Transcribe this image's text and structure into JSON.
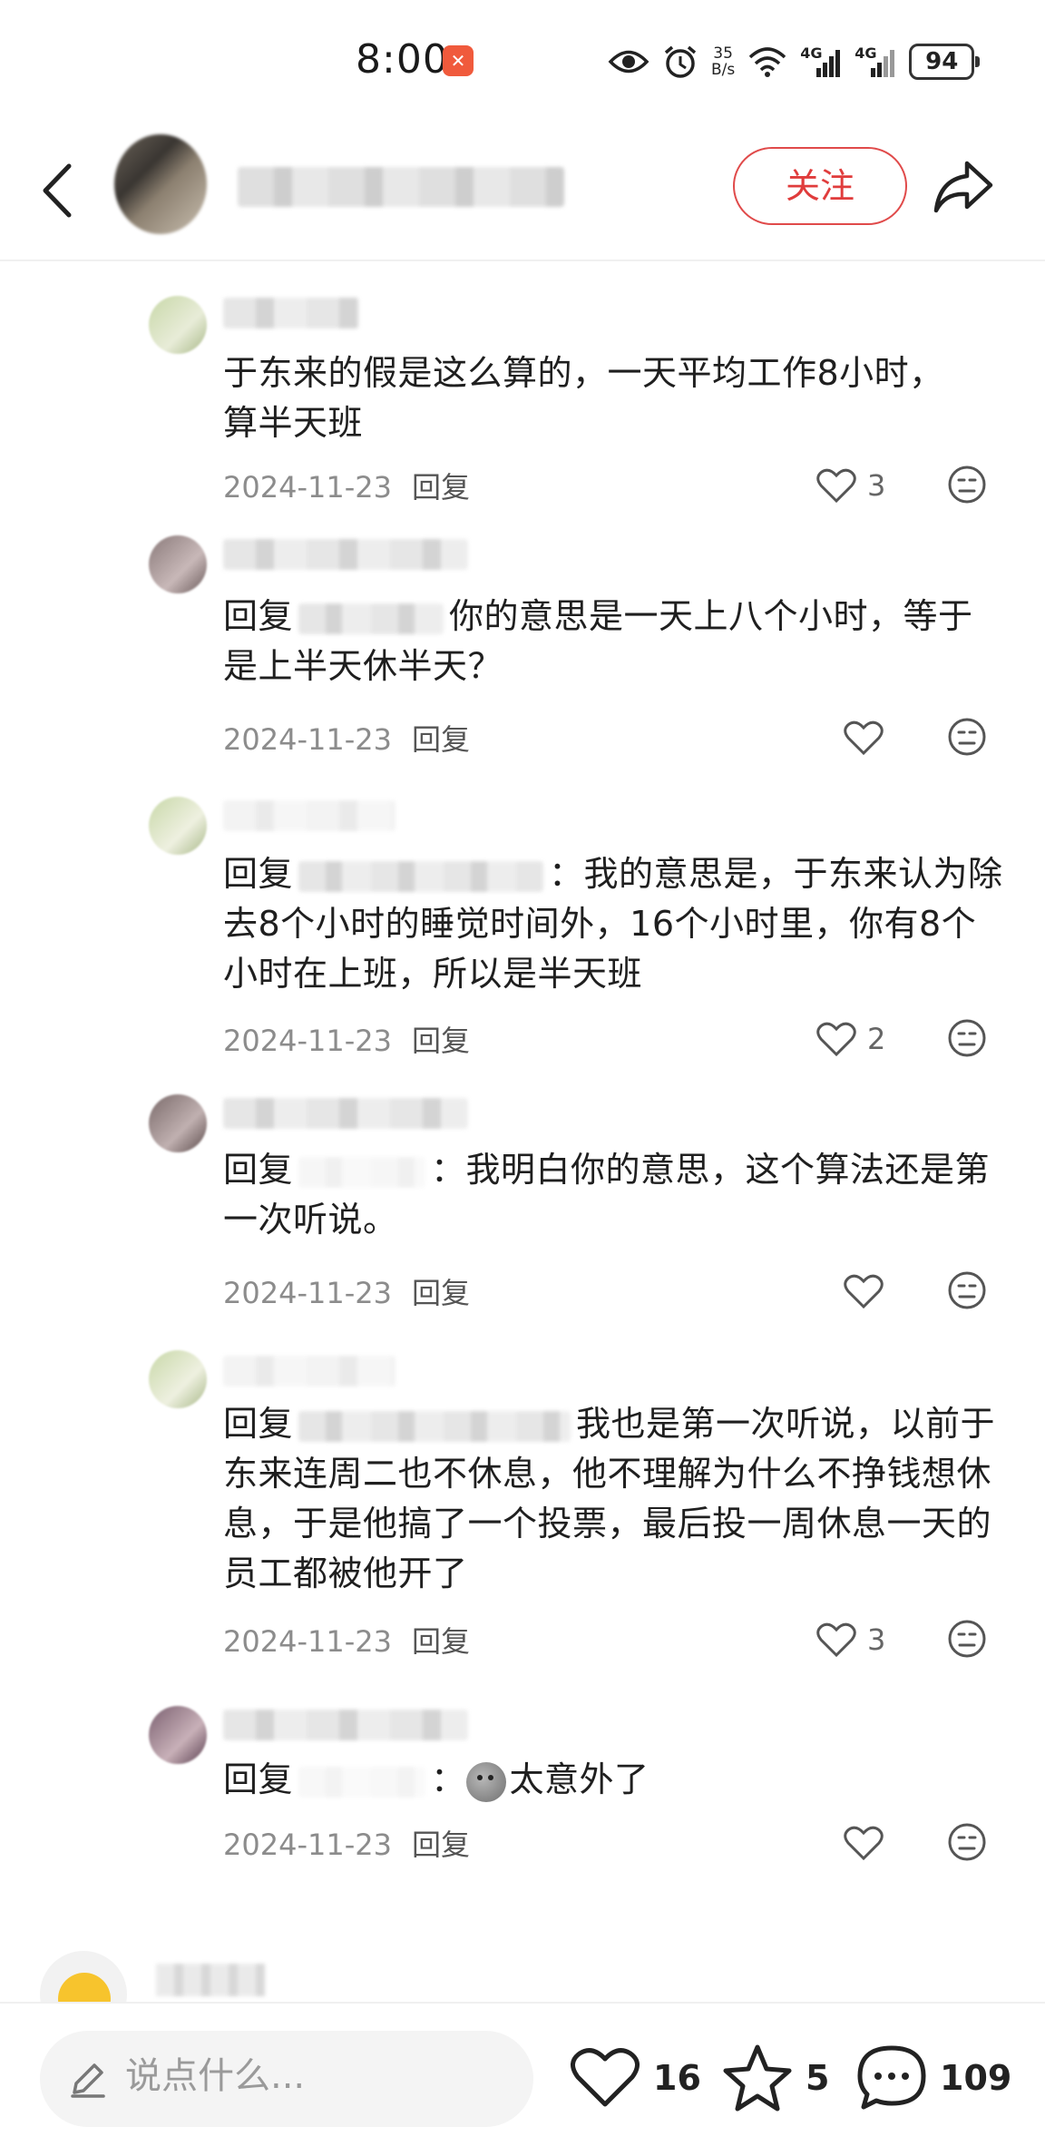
{
  "status_bar": {
    "time": "8:00",
    "net_speed_value": "35",
    "net_speed_unit": "B/s",
    "signal1_label": "4G",
    "signal2_label": "4G",
    "battery": "94"
  },
  "header": {
    "follow_label": "关注"
  },
  "comments": [
    {
      "text": "于东来的假是这么算的，一天平均工作8小时，算半天班",
      "date": "2024-11-23",
      "reply_label": "回复",
      "likes": "3"
    },
    {
      "reply_prefix": "回复",
      "text": "你的意思是一天上八个小时，等于是上半天休半天？",
      "date": "2024-11-23",
      "reply_label": "回复",
      "likes": ""
    },
    {
      "reply_prefix": "回复",
      "text": "：我的意思是，于东来认为除去8个小时的睡觉时间外，16个小时里，你有8个小时在上班，所以是半天班",
      "date": "2024-11-23",
      "reply_label": "回复",
      "likes": "2"
    },
    {
      "reply_prefix": "回复",
      "text": "：我明白你的意思，这个算法还是第一次听说。",
      "date": "2024-11-23",
      "reply_label": "回复",
      "likes": ""
    },
    {
      "reply_prefix": "回复",
      "text": "我也是第一次听说，以前于东来连周二也不休息，他不理解为什么不挣钱想休息，于是他搞了一个投票，最后投一周休息一天的员工都被他开了",
      "date": "2024-11-23",
      "reply_label": "回复",
      "likes": "3"
    },
    {
      "reply_prefix": "回复",
      "text": "：",
      "text_after_emoji": "太意外了",
      "date": "2024-11-23",
      "reply_label": "回复",
      "likes": ""
    }
  ],
  "bottom_bar": {
    "input_placeholder": "说点什么...",
    "likes": "16",
    "favorites": "5",
    "comments": "109"
  },
  "colors": {
    "accent_red": "#e03c3c",
    "meta_gray": "#8c8c8c"
  }
}
